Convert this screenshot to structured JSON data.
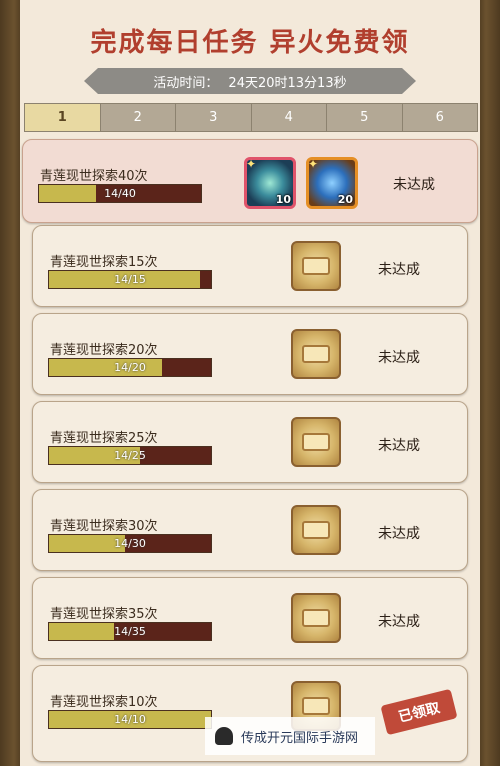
{
  "title": "完成每日任务 异火免费领",
  "timer": {
    "label": "活动时间：",
    "value": "24天20时13分13秒"
  },
  "tabs": [
    "1",
    "2",
    "3",
    "4",
    "5",
    "6"
  ],
  "active_tab": "1",
  "tasks": [
    {
      "name": "青莲现世探索40次",
      "progress_text": "14/40",
      "progress": 0.35,
      "status": "未达成",
      "rewards": [
        {
          "icon": "lotus-flame-icon",
          "count": "10"
        },
        {
          "icon": "blue-flame-icon",
          "count": "20"
        }
      ]
    },
    {
      "name": "青莲现世探索15次",
      "progress_text": "14/15",
      "progress": 0.93,
      "status": "未达成",
      "rewards": [
        {
          "icon": "scroll-icon"
        }
      ]
    },
    {
      "name": "青莲现世探索20次",
      "progress_text": "14/20",
      "progress": 0.7,
      "status": "未达成",
      "rewards": [
        {
          "icon": "scroll-icon"
        }
      ]
    },
    {
      "name": "青莲现世探索25次",
      "progress_text": "14/25",
      "progress": 0.56,
      "status": "未达成",
      "rewards": [
        {
          "icon": "scroll-icon"
        }
      ]
    },
    {
      "name": "青莲现世探索30次",
      "progress_text": "14/30",
      "progress": 0.47,
      "status": "未达成",
      "rewards": [
        {
          "icon": "scroll-icon"
        }
      ]
    },
    {
      "name": "青莲现世探索35次",
      "progress_text": "14/35",
      "progress": 0.4,
      "status": "未达成",
      "rewards": [
        {
          "icon": "scroll-icon"
        }
      ]
    },
    {
      "name": "青莲现世探索10次",
      "progress_text": "14/10",
      "progress": 1.0,
      "status": "已领取",
      "rewards": [
        {
          "icon": "scroll-icon"
        }
      ]
    }
  ],
  "watermark": "传成开元国际手游网",
  "colors": {
    "title": "#b13f2e",
    "progress_fill": "#c7b84d",
    "progress_track": "#5b241a",
    "claimed_stamp": "#c04a39"
  }
}
